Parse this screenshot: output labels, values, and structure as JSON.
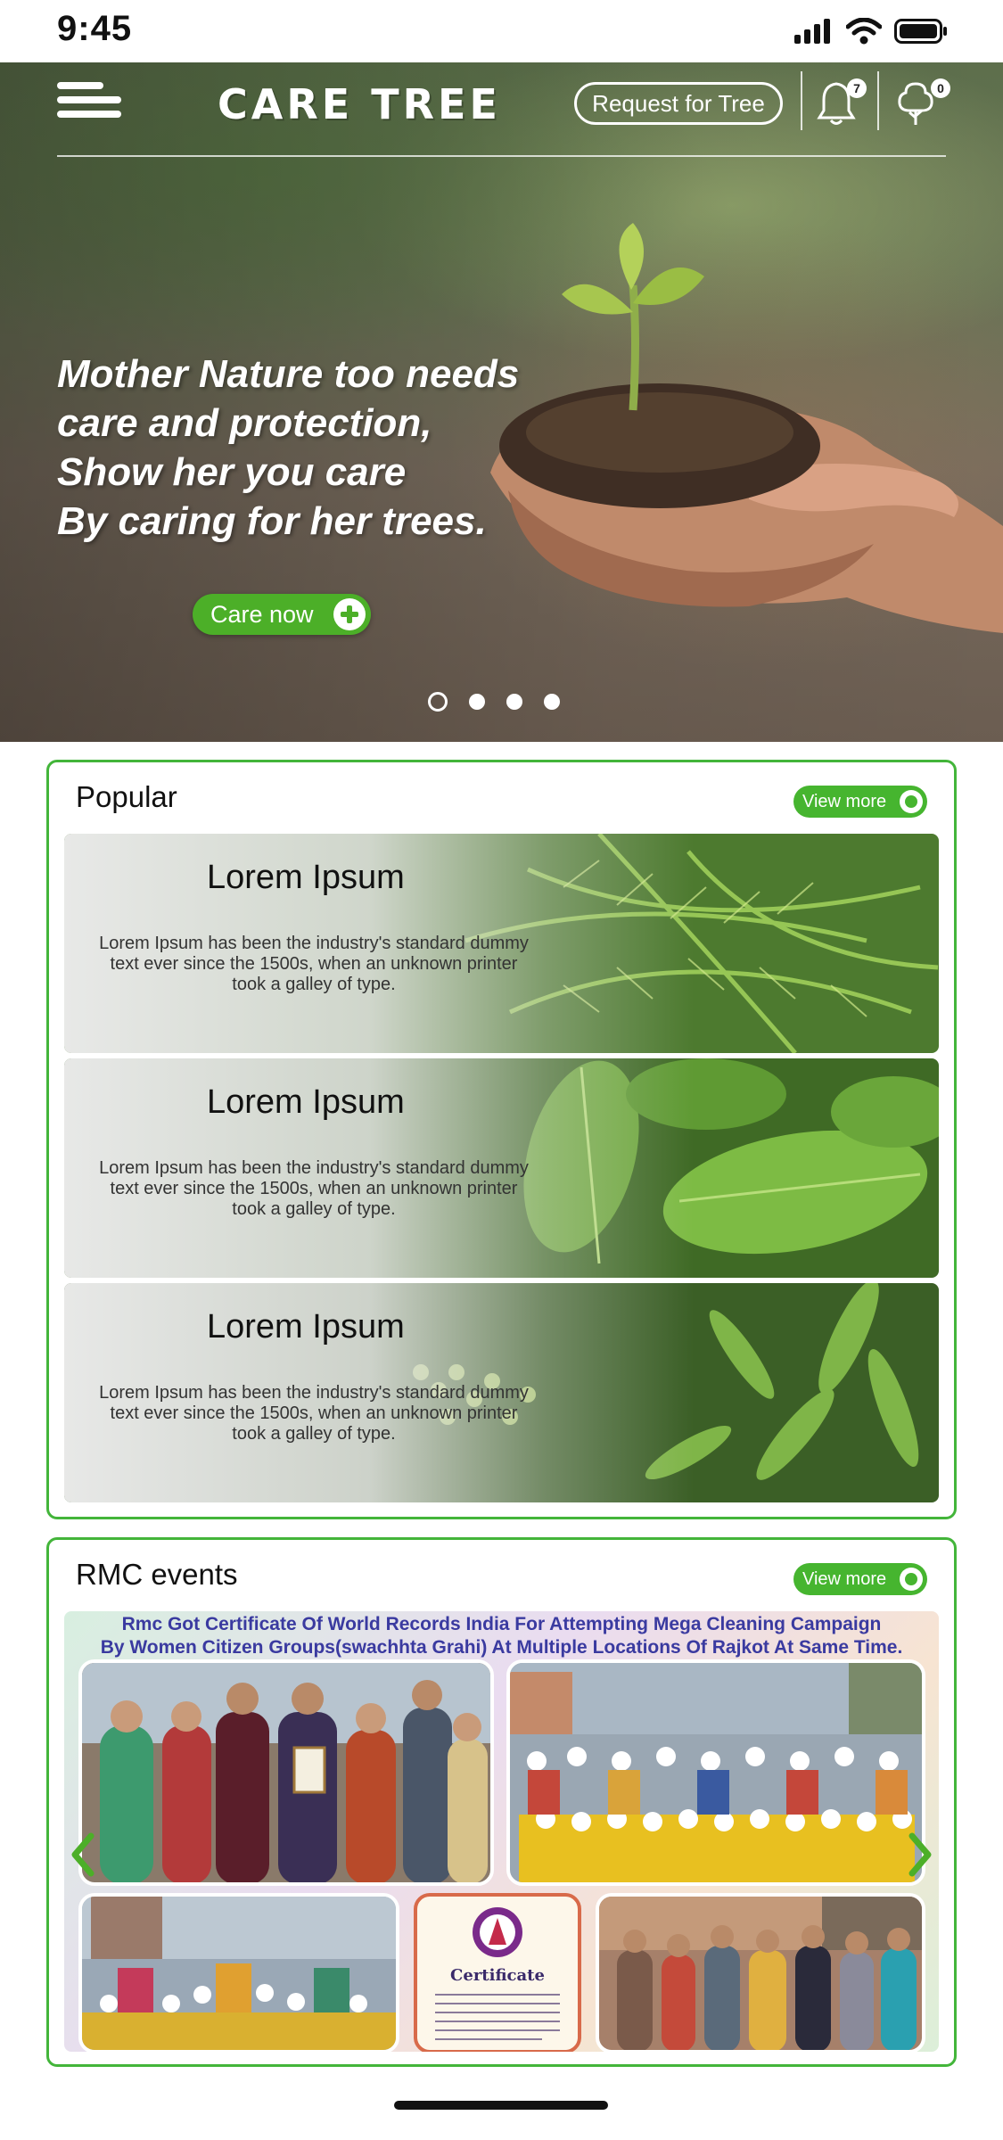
{
  "status_bar": {
    "time": "9:45"
  },
  "header": {
    "brand": "CARE TREE",
    "request_label": "Request for Tree",
    "notifications_count": "7",
    "trees_count": "0"
  },
  "hero": {
    "lines": [
      "Mother Nature too needs",
      "care and protection,",
      "Show her you care",
      "By caring for her trees."
    ],
    "cta_label": "Care now",
    "slides_total": 4,
    "active_slide": 1
  },
  "popular": {
    "title": "Popular",
    "view_more": "View more",
    "items": [
      {
        "title": "Lorem Ipsum",
        "desc": "Lorem Ipsum has been the industry's standard dummy text ever since the 1500s, when an unknown printer took a galley of type."
      },
      {
        "title": "Lorem Ipsum",
        "desc": "Lorem Ipsum has been the industry's standard dummy text ever since the 1500s, when an unknown printer took a galley of type."
      },
      {
        "title": "Lorem Ipsum",
        "desc": "Lorem Ipsum has been the industry's standard dummy text ever since the 1500s, when an unknown printer took a galley of type."
      }
    ]
  },
  "events": {
    "title": "RMC events",
    "view_more": "View more",
    "banner_line1": "Rmc Got Certificate Of World Records India For Attempting Mega Cleaning Campaign",
    "banner_line2": "By Women Citizen Groups(swachhta Grahi) At Multiple Locations Of Rajkot At Same Time.",
    "certificate_label": "Certificate"
  },
  "colors": {
    "accent": "#43b53a",
    "button": "#4caf28",
    "event_text": "#3a3aa0"
  }
}
